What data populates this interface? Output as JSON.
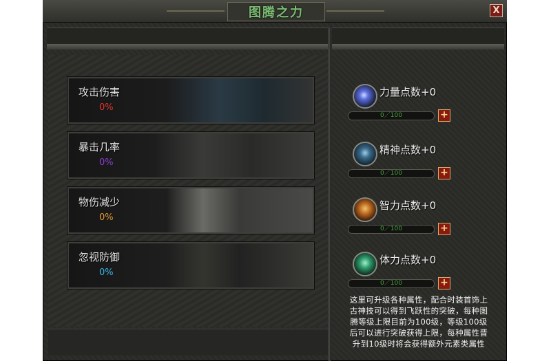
{
  "window": {
    "title": "图腾之力",
    "close_label": "X"
  },
  "stats": [
    {
      "label": "攻击伤害",
      "value": "0%",
      "color": "#e5322b"
    },
    {
      "label": "暴击几率",
      "value": "0%",
      "color": "#8a3fd0"
    },
    {
      "label": "物伤减少",
      "value": "0%",
      "color": "#e39a2e"
    },
    {
      "label": "忽视防御",
      "value": "0%",
      "color": "#38b7e6"
    }
  ],
  "attributes": [
    {
      "name": "力量点数+0",
      "progress": "0／100",
      "icon": "power-orb-icon",
      "color": "#6a8cff"
    },
    {
      "name": "精神点数+0",
      "progress": "0／100",
      "icon": "spirit-orb-icon",
      "color": "#6fa2c8"
    },
    {
      "name": "智力点数+0",
      "progress": "0／100",
      "icon": "intellect-orb-icon",
      "color": "#d08a2a"
    },
    {
      "name": "体力点数+0",
      "progress": "0／100",
      "icon": "stamina-orb-icon",
      "color": "#3fbf8a"
    }
  ],
  "add_label": "+",
  "description": [
    "这里可升级各种属性，配合时装首饰上",
    "古神技可以得到飞跃性的突破，每种图",
    "腾等级上限目前为100级，等级100级",
    "后可以进行突破获得上限，每种属性晋",
    "升到10级时将会获得额外元素类属性"
  ]
}
